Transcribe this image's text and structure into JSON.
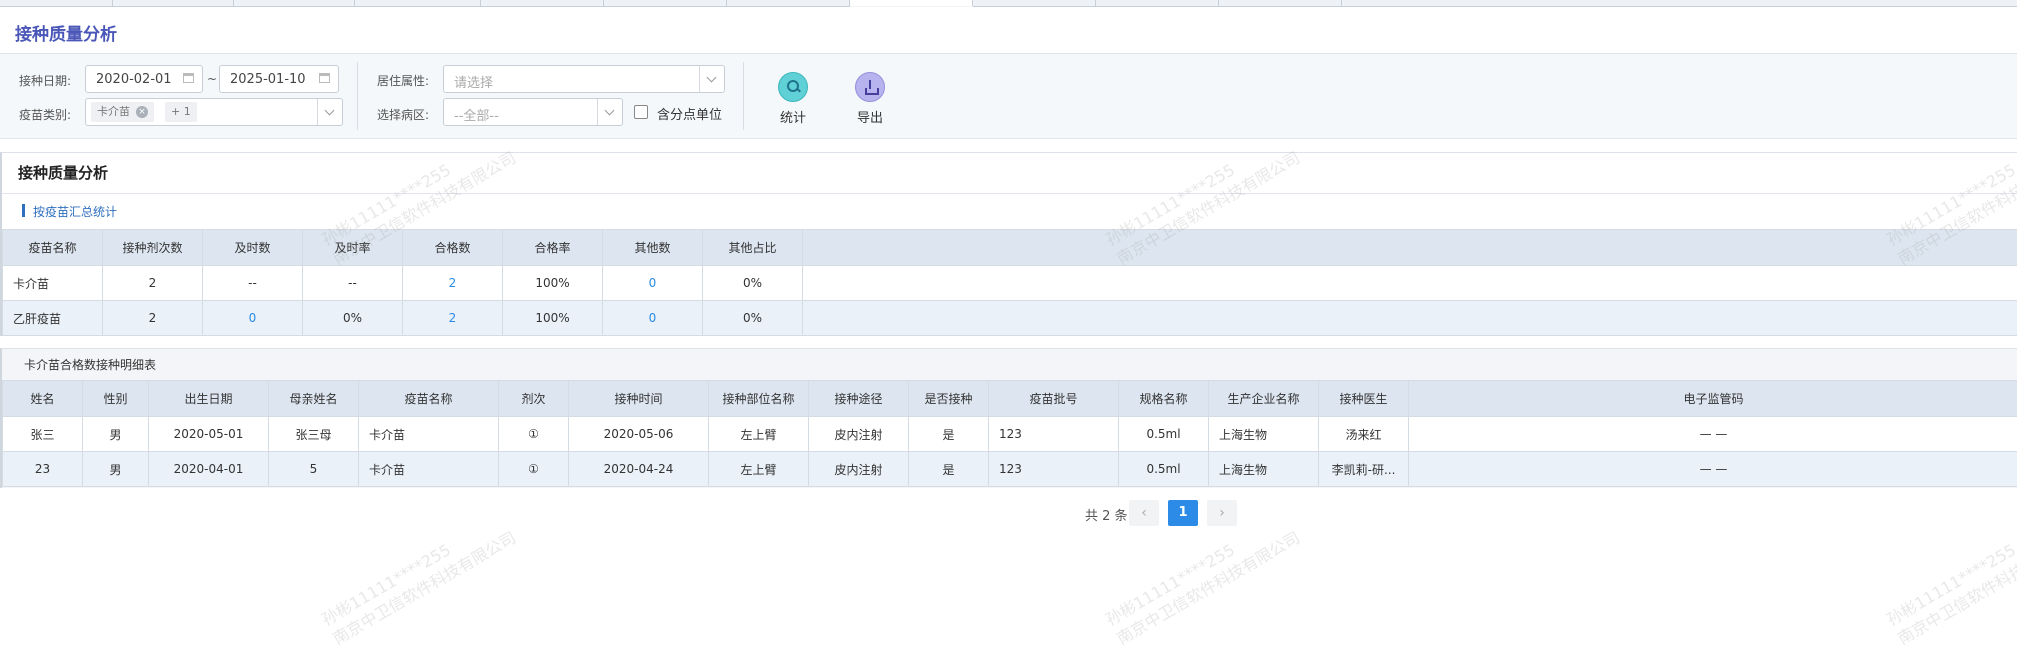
{
  "page_title": "接种质量分析",
  "filters": {
    "date_label": "接种日期:",
    "date_from": "2020-02-01",
    "date_sep": "~",
    "date_to": "2025-01-10",
    "vaccine_label": "疫苗类别:",
    "vaccine_chip": "卡介苗",
    "vaccine_chip_remove": "×",
    "vaccine_more": "+ 1",
    "residence_label": "居住属性:",
    "residence_placeholder": "请选择",
    "ward_label": "选择病区:",
    "ward_value": "--全部--",
    "include_sub_label": "含分点单位"
  },
  "toolbar": {
    "stats_label": "统计",
    "export_label": "导出",
    "stats_icon": "search-icon",
    "export_icon": "upload-icon"
  },
  "summary": {
    "panel_title": "接种质量分析",
    "sub_title": "按疫苗汇总统计",
    "columns": [
      "疫苗名称",
      "接种剂次数",
      "及时数",
      "及时率",
      "合格数",
      "合格率",
      "其他数",
      "其他占比"
    ],
    "rows": [
      [
        "卡介苗",
        "2",
        "--",
        "--",
        "2",
        "100%",
        "0",
        "0%"
      ],
      [
        "乙肝疫苗",
        "2",
        "0",
        "0%",
        "2",
        "100%",
        "0",
        "0%"
      ]
    ]
  },
  "detail": {
    "title": "卡介苗合格数接种明细表",
    "columns": [
      "姓名",
      "性别",
      "出生日期",
      "母亲姓名",
      "疫苗名称",
      "剂次",
      "接种时间",
      "接种部位名称",
      "接种途径",
      "是否接种",
      "疫苗批号",
      "规格名称",
      "生产企业名称",
      "接种医生",
      "电子监管码"
    ],
    "rows": [
      [
        "张三",
        "男",
        "2020-05-01",
        "张三母",
        "卡介苗",
        "①",
        "2020-05-06",
        "左上臂",
        "皮内注射",
        "是",
        "123",
        "0.5ml",
        "上海生物",
        "汤来红",
        "— —"
      ],
      [
        "23",
        "男",
        "2020-04-01",
        "5",
        "卡介苗",
        "①",
        "2020-04-24",
        "左上臂",
        "皮内注射",
        "是",
        "123",
        "0.5ml",
        "上海生物",
        "李凯莉-研...",
        "— —"
      ]
    ]
  },
  "pagination": {
    "total_text": "共 2 条",
    "prev": "‹",
    "current": "1",
    "next": "›"
  },
  "watermark": {
    "line1": "孙彬11111****255",
    "line2": "南京中卫信软件科技有限公司"
  },
  "colors": {
    "accent": "#2b8be6",
    "title": "#4a57b8",
    "header_bg": "#dde6f0",
    "stripe": "#eaf1f8"
  }
}
